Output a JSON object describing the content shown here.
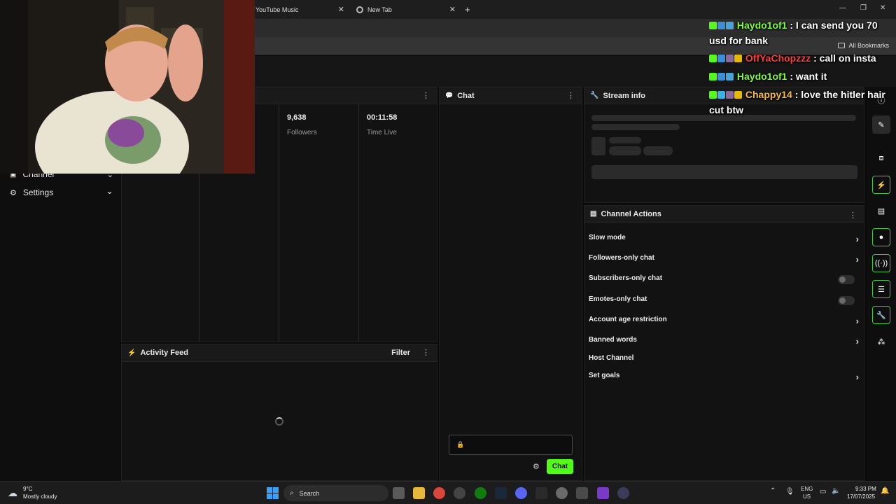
{
  "browser": {
    "tabs": [
      {
        "title": "YouTube Music"
      },
      {
        "title": "New Tab"
      }
    ],
    "new_tab": "+",
    "bookmarks_all": "All Bookmarks"
  },
  "sidebar": {
    "items": [
      {
        "label": "Channel"
      },
      {
        "label": "Settings"
      }
    ]
  },
  "stats": [
    {
      "value": "9,638",
      "label": "Followers"
    },
    {
      "value": "00:11:58",
      "label": "Time Live"
    }
  ],
  "chat_panel": {
    "title": "Chat",
    "send_label": "Chat"
  },
  "stream_info": {
    "title": "Stream info"
  },
  "channel_actions": {
    "title": "Channel Actions",
    "items": [
      {
        "label": "Slow mode",
        "control": "arrow"
      },
      {
        "label": "Followers-only chat",
        "control": "arrow"
      },
      {
        "label": "Subscribers-only chat",
        "control": "toggle"
      },
      {
        "label": "Emotes-only chat",
        "control": "toggle"
      },
      {
        "label": "Account age restriction",
        "control": "arrow"
      },
      {
        "label": "Banned words",
        "control": "arrow"
      },
      {
        "label": "Host Channel",
        "control": "none"
      },
      {
        "label": "Set goals",
        "control": "arrow"
      }
    ]
  },
  "activity_feed": {
    "title": "Activity Feed",
    "filter": "Filter"
  },
  "overlay_chat": [
    {
      "user": "Haydo1of1",
      "user_color": "#7CFC3B",
      "message": " : I can send you 70 usd for bank"
    },
    {
      "user": "OffYaChopzzz",
      "user_color": "#FF3B3B",
      "message": " : call on insta"
    },
    {
      "user": "Haydo1of1",
      "user_color": "#7CFC3B",
      "message": " : want it"
    },
    {
      "user": "Chappy14",
      "user_color": "#F5B842",
      "message": " : love the hitler hair cut btw"
    }
  ],
  "taskbar": {
    "weather_temp": "9°C",
    "weather_desc": "Mostly cloudy",
    "search": "Search",
    "lang": "ENG",
    "region": "US",
    "time": "9:33 PM",
    "date": "17/07/2025"
  },
  "colors": {
    "accent_green": "#53FC18",
    "panel_bg": "#121212"
  }
}
